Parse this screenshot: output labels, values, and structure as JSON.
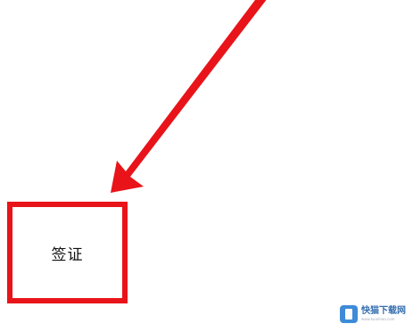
{
  "menu": {
    "visa_label": "签证"
  },
  "annotation": {
    "arrow_color": "#e8141a",
    "highlight_color": "#e8141a"
  },
  "watermark": {
    "site_name": "快猫下载网",
    "url": "www.kuaimao.com"
  }
}
